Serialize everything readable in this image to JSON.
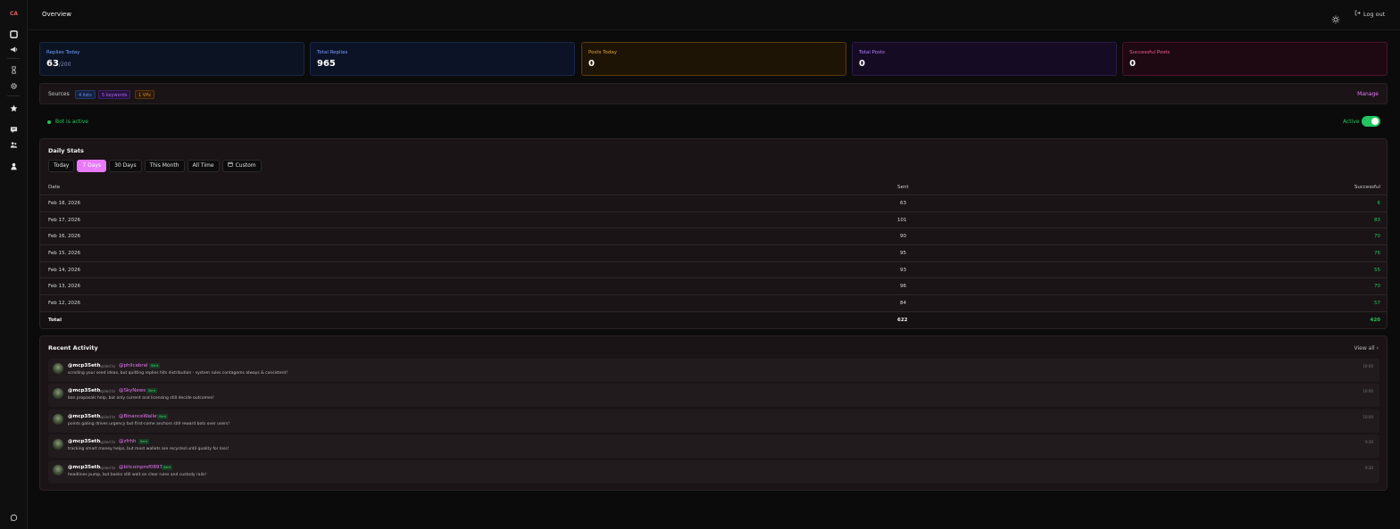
{
  "sidebar": {
    "logo": "CA",
    "icons": [
      "square-icon",
      "megaphone-icon",
      "hourglass-icon",
      "gear-icon",
      "star-icon",
      "chat-icon",
      "users-icon",
      "user-icon",
      "help-chat-icon"
    ]
  },
  "topbar": {
    "title": "Overview",
    "logout_label": "Log out",
    "theme_icon": "sun-icon"
  },
  "stats": [
    {
      "label": "Replies Today",
      "value": "63",
      "sub": "/200",
      "color": "#6ea0ff"
    },
    {
      "label": "Total Replies",
      "value": "965",
      "color": "#7a9cff"
    },
    {
      "label": "Posts Today",
      "value": "0",
      "color": "#e3a33b"
    },
    {
      "label": "Total Posts",
      "value": "0",
      "color": "#b87cff"
    },
    {
      "label": "Successful Posts",
      "value": "0",
      "color": "#ff5c8e"
    }
  ],
  "sources": {
    "label": "Sources",
    "pills": [
      "4 lists",
      "5 keywords",
      "1 VPs"
    ],
    "manage_label": "Manage"
  },
  "bot": {
    "status_text": "Bot is active",
    "toggle_label": "Active",
    "toggle_on": true
  },
  "daily_stats": {
    "title": "Daily Stats",
    "tabs": [
      "Today",
      "7 Days",
      "30 Days",
      "This Month",
      "All Time",
      "Custom"
    ],
    "active_tab": "7 Days",
    "columns": [
      "Date",
      "Sent",
      "Successful"
    ],
    "rows": [
      {
        "date": "Feb 18, 2026",
        "sent": "63",
        "successful": "6"
      },
      {
        "date": "Feb 17, 2026",
        "sent": "101",
        "successful": "83"
      },
      {
        "date": "Feb 16, 2026",
        "sent": "90",
        "successful": "70"
      },
      {
        "date": "Feb 15, 2026",
        "sent": "95",
        "successful": "76"
      },
      {
        "date": "Feb 14, 2026",
        "sent": "93",
        "successful": "55"
      },
      {
        "date": "Feb 13, 2026",
        "sent": "96",
        "successful": "70"
      },
      {
        "date": "Feb 12, 2026",
        "sent": "84",
        "successful": "57"
      }
    ],
    "total": {
      "label": "Total",
      "sent": "622",
      "successful": "420"
    }
  },
  "recent_activity": {
    "title": "Recent Activity",
    "view_all_label": "View all",
    "items": [
      {
        "user": "@mcp35eth",
        "verb": "replied to",
        "target": "@philcabral",
        "badge": "Sent",
        "text": "scrolling your seed ideas, but quitting replies hits distribution - system rules contagems always & consistent!",
        "time": "10:00"
      },
      {
        "user": "@mcp35eth",
        "verb": "replied to",
        "target": "@SkyNews",
        "badge": "Sent",
        "text": "ban proposals help, but only current and licensing still decide outcomes!",
        "time": "10:00"
      },
      {
        "user": "@mcp35eth",
        "verb": "replied to",
        "target": "@BinanceWallet",
        "badge": "Sent",
        "text": "points gating drives urgency but first-come anchors still reward bots over users!",
        "time": "10:00"
      },
      {
        "user": "@mcp35eth",
        "verb": "replied to",
        "target": "@zfrhh",
        "badge": "Sent",
        "text": "tracking smart money helps, but most wallets are recycled until quality for loss!",
        "time": "9:30"
      },
      {
        "user": "@mcp35eth",
        "verb": "replied to",
        "target": "@bitcoinprof0897",
        "badge": "Sent",
        "text": "headlines pump, but banks still wait on clear rules and custody rails!",
        "time": "9:30"
      }
    ]
  }
}
